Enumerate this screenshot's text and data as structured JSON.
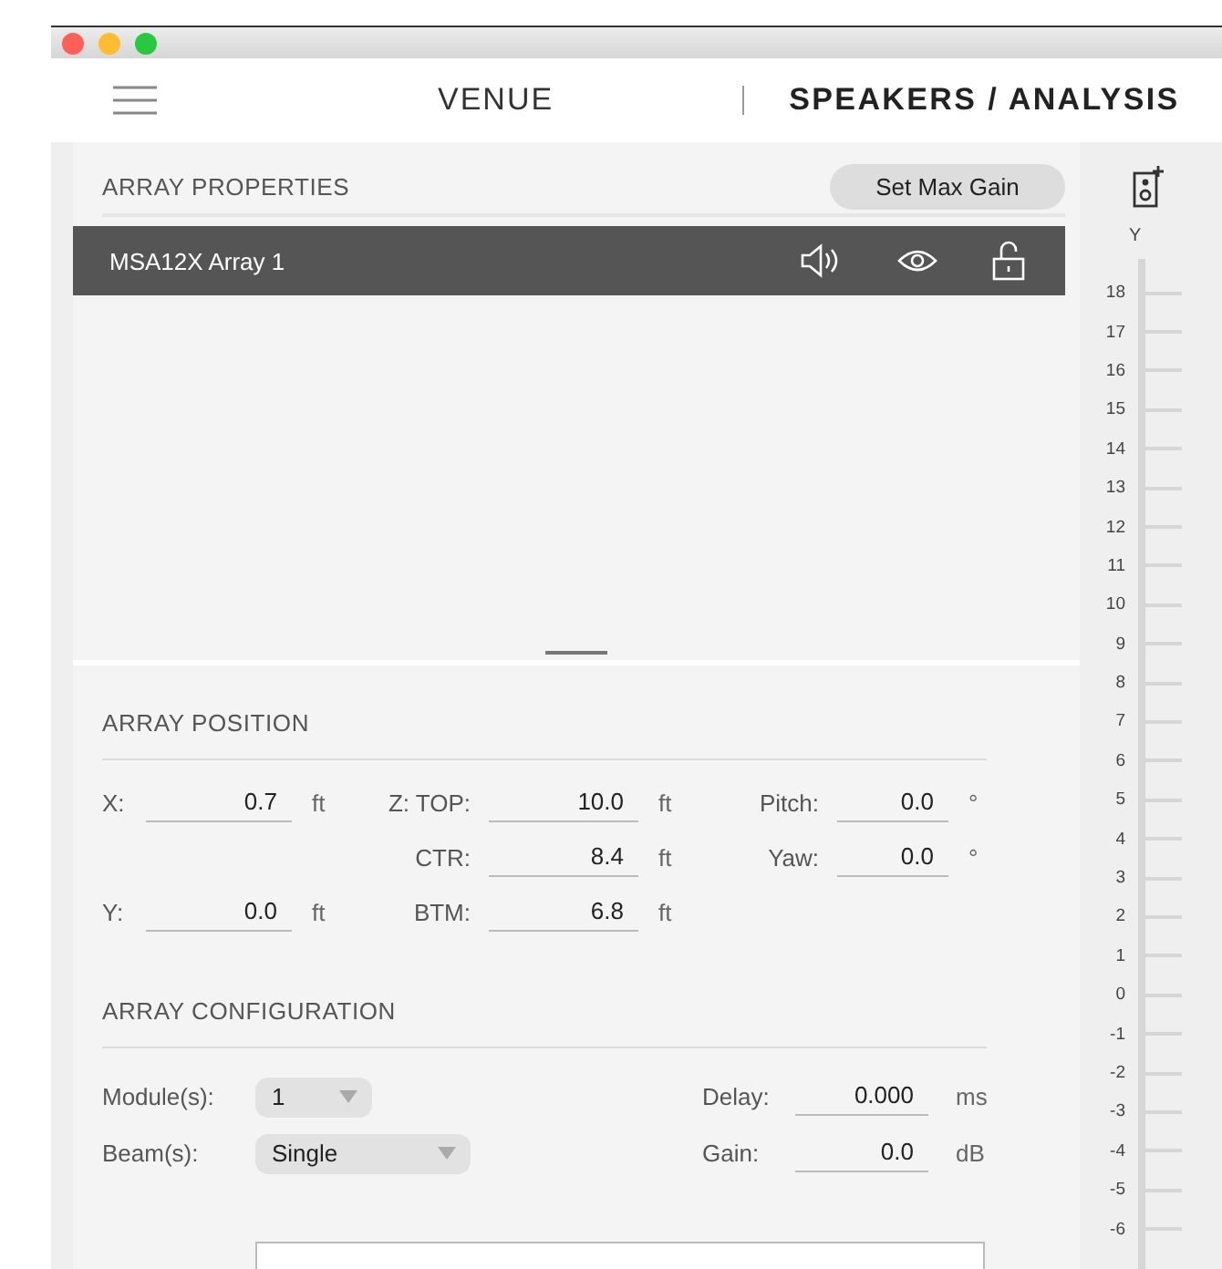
{
  "nav": {
    "tabs": [
      {
        "label": "VENUE",
        "selected": false
      },
      {
        "label": "SPEAKERS / ANALYSIS",
        "selected": true
      }
    ]
  },
  "array_properties": {
    "title": "ARRAY PROPERTIES",
    "button": "Set Max Gain",
    "arrays": [
      {
        "name": "MSA12X Array 1",
        "selected": true
      }
    ]
  },
  "array_position": {
    "title": "ARRAY POSITION",
    "rows": [
      {
        "cells": [
          {
            "kind": "field",
            "label": "X:",
            "value": "0.7",
            "unit": "ft"
          },
          {
            "kind": "field",
            "label": "Z: TOP:",
            "value": "10.0",
            "unit": "ft"
          },
          {
            "kind": "field",
            "label": "Pitch:",
            "value": "0.0",
            "unit": "°"
          }
        ]
      },
      {
        "cells": [
          {
            "kind": "empty"
          },
          {
            "kind": "field",
            "label": "CTR:",
            "value": "8.4",
            "unit": "ft"
          },
          {
            "kind": "field",
            "label": "Yaw:",
            "value": "0.0",
            "unit": "°"
          }
        ]
      },
      {
        "cells": [
          {
            "kind": "field",
            "label": "Y:",
            "value": "0.0",
            "unit": "ft"
          },
          {
            "kind": "field",
            "label": "BTM:",
            "value": "6.8",
            "unit": "ft"
          },
          {
            "kind": "empty"
          }
        ]
      }
    ]
  },
  "array_configuration": {
    "title": "ARRAY CONFIGURATION",
    "rows": [
      {
        "left": {
          "label": "Module(s):",
          "value": "1",
          "kind": "count"
        },
        "right": {
          "label": "Delay:",
          "value": "0.000",
          "unit": "ms"
        }
      },
      {
        "left": {
          "label": "Beam(s):",
          "value": "Single",
          "kind": "choice"
        },
        "right": {
          "label": "Gain:",
          "value": "0.0",
          "unit": "dB"
        }
      }
    ]
  },
  "ruler": {
    "axis_label": "Y",
    "ticks": [
      "18",
      "17",
      "16",
      "15",
      "14",
      "13",
      "12",
      "11",
      "10",
      "9",
      "8",
      "7",
      "6",
      "5",
      "4",
      "3",
      "2",
      "1",
      "0",
      "-1",
      "-2",
      "-3",
      "-4",
      "-5",
      "-6"
    ]
  }
}
